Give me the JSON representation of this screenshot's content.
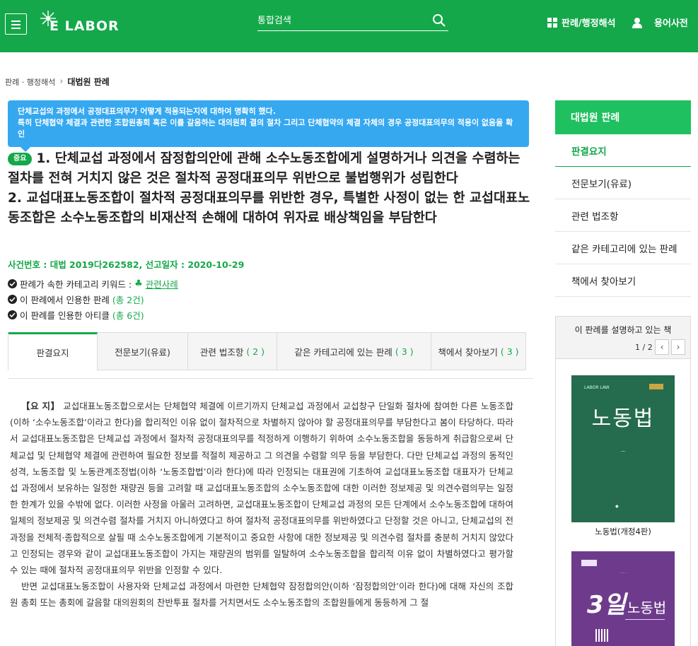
{
  "header": {
    "logo_text": "E LABOR",
    "search_placeholder": "통합검색",
    "nav_precedents": "판례/행정해석",
    "nav_glossary": "용어사전"
  },
  "breadcrumb": {
    "parent": "판례 · 행정해석",
    "current": "대법원 판례"
  },
  "summary_box": {
    "line1": "단체교섭의 과정에서 공정대표의무가 어떻게 적용되는지에 대하여 명확히 했다.",
    "line2": "특히 단체협약 체결과 관련한 조합원총회 혹은 이를 갈음하는 대의원회 결의 절차 그리고 단체협약의 체결 자체의 경우 공정대표의무의 적용이 없음을 확인"
  },
  "title": {
    "badge": "중요",
    "point1": "1. 단체교섭 과정에서 잠정합의안에 관해 소수노동조합에게 설명하거나 의견을 수렴하는 절차를 전혀 거치지 않은 것은 절차적 공정대표의무 위반으로 불법행위가 성립한다",
    "point2": "2. 교섭대표노동조합이 절차적 공정대표의무를 위반한 경우, 특별한 사정이 없는 한 교섭대표노동조합은 소수노동조합의 비재산적 손해에 대하여 위자료 배상책임을 부담한다"
  },
  "case_info": "사건번호 : 대법 2019다262582,  선고일자 : 2020-10-29",
  "meta": {
    "keyword_label": "판례가 속한 카테고리 키워드 :",
    "keyword_link": "관련사례",
    "cited_label": "이 판례에서 인용한 판례",
    "cited_count": "(총 2건)",
    "citing_label": "이 판례를 인용한 아티클",
    "citing_count": "(총 6건)"
  },
  "tabs": [
    {
      "label": "판결요지",
      "count": ""
    },
    {
      "label": "전문보기(유료)",
      "count": ""
    },
    {
      "label": "관련 법조항",
      "count": "( 2 )"
    },
    {
      "label": "같은 카테고리에 있는 판례",
      "count": "( 3 )"
    },
    {
      "label": "책에서 찾아보기",
      "count": "( 3 )"
    }
  ],
  "body": {
    "heading": "【요 지】",
    "para1": "교섭대표노동조합으로서는 단체협약 체결에 이르기까지 단체교섭 과정에서 교섭창구 단일화 절차에 참여한 다른 노동조합(이하 ‘소수노동조합’이라고 한다)을 합리적인 이유 없이 절차적으로 차별하지 않아야 할 공정대표의무를 부담한다고 봄이 타당하다. 따라서 교섭대표노동조합은 단체교섭 과정에서 절차적 공정대표의무를 적정하게 이행하기 위하여 소수노동조합을 동등하게 취급함으로써 단체교섭 및 단체협약 체결에 관련하여 필요한 정보를 적절히 제공하고 그 의견을 수렴할 의무 등을 부담한다. 다만 단체교섭 과정의 동적인 성격, 노동조합 및 노동관계조정법(이하 ‘노동조합법’이라 한다)에 따라 인정되는 대표권에 기초하여 교섭대표노동조합 대표자가 단체교섭 과정에서 보유하는 일정한 재량권 등을 고려할 때 교섭대표노동조합의 소수노동조합에 대한 이러한 정보제공 및 의견수렴의무는 일정한 한계가 있을 수밖에 없다. 이러한 사정을 아울러 고려하면, 교섭대표노동조합이 단체교섭 과정의 모든 단계에서 소수노동조합에 대하여 일체의 정보제공 및 의견수렴 절차를 거치지 아니하였다고 하여 절차적 공정대표의무를 위반하였다고 단정할 것은 아니고, 단체교섭의 전 과정을 전체적·종합적으로 살필 때 소수노동조합에게 기본적이고 중요한 사항에 대한 정보제공 및 의견수렴 절차를 충분히 거치지 않았다고 인정되는 경우와 같이 교섭대표노동조합이 가지는 재량권의 범위를 일탈하여 소수노동조합을 합리적 이유 없이 차별하였다고 평가할 수 있는 때에 절차적 공정대표의무 위반을 인정할 수 있다.",
    "para2": "반면 교섭대표노동조합이 사용자와 단체교섭 과정에서 마련한 단체협약 잠정합의안(이하 ‘잠정합의안’이라 한다)에 대해 자신의 조합원 총회 또는 총회에 갈음할 대의원회의 찬반투표 절차를 거치면서도 소수노동조합의 조합원들에게 동등하게 그 절"
  },
  "sidebar": {
    "head": "대법원 판례",
    "items": [
      "판결요지",
      "전문보기(유료)",
      "관련 법조항",
      "같은 카테고리에 있는 판례",
      "책에서 찾아보기"
    ]
  },
  "book_panel": {
    "title": "이 판례를 설명하고 있는 책",
    "pager": "1 / 2",
    "book1": {
      "series": "LABOR LAW",
      "title": "노동법",
      "caption": "노동법(개정4판)"
    },
    "book2": {
      "title_big": "3일",
      "title_small": "노동법"
    }
  }
}
